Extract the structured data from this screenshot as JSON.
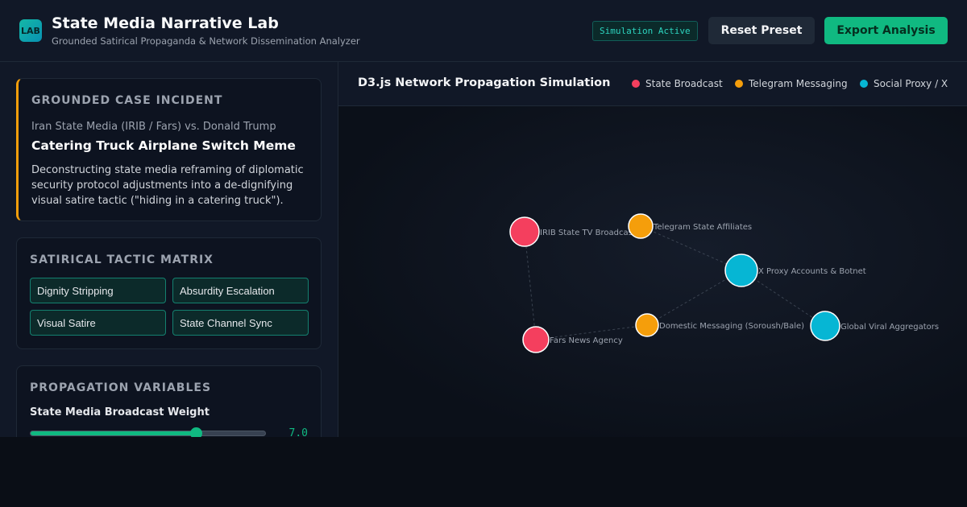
{
  "header": {
    "logo": "LAB",
    "title": "State Media Narrative Lab",
    "subtitle": "Grounded Satirical Propaganda & Network Dissemination Analyzer",
    "status": "Simulation Active",
    "reset_label": "Reset Preset",
    "export_label": "Export Analysis"
  },
  "incident": {
    "heading": "GROUNDED CASE INCIDENT",
    "source": "Iran State Media (IRIB / Fars) vs. Donald Trump",
    "title": "Catering Truck Airplane Switch Meme",
    "description": "Deconstructing state media reframing of diplomatic security protocol adjustments into a de-dignifying visual satire tactic (\"hiding in a catering truck\")."
  },
  "tactics": {
    "heading": "SATIRICAL TACTIC MATRIX",
    "items": [
      "Dignity Stripping",
      "Absurdity Escalation",
      "Visual Satire",
      "State Channel Sync"
    ]
  },
  "propagation": {
    "heading": "PROPAGATION VARIABLES",
    "slider_label": "State Media Broadcast Weight",
    "slider_value": 7.0,
    "slider_display": "7.0",
    "slider_max": 10
  },
  "network": {
    "title": "D3.js Network Propagation Simulation",
    "legend": [
      {
        "label": "State Broadcast",
        "color": "#f43f5e"
      },
      {
        "label": "Telegram Messaging",
        "color": "#f59e0b"
      },
      {
        "label": "Social Proxy / X",
        "color": "#06b6d4"
      }
    ],
    "nodes": [
      {
        "id": "irib",
        "label": "IRIB State TV Broadcast",
        "group": 0
      },
      {
        "id": "fars",
        "label": "Fars News Agency",
        "group": 0
      },
      {
        "id": "tg",
        "label": "Telegram State Affiliates",
        "group": 1
      },
      {
        "id": "dom",
        "label": "Domestic Messaging (Soroush/Bale)",
        "group": 1
      },
      {
        "id": "proxy",
        "label": "X Proxy Accounts & Botnet",
        "group": 2
      },
      {
        "id": "agg",
        "label": "Global Viral Aggregators",
        "group": 2
      }
    ],
    "links": [
      [
        "irib",
        "fars"
      ],
      [
        "fars",
        "dom"
      ],
      [
        "dom",
        "proxy"
      ],
      [
        "tg",
        "proxy"
      ],
      [
        "proxy",
        "agg"
      ]
    ]
  },
  "colors": {
    "accent": "#10b981",
    "state": "#f43f5e",
    "telegram": "#f59e0b",
    "proxy": "#06b6d4",
    "incident_border": "#f59e0b"
  }
}
